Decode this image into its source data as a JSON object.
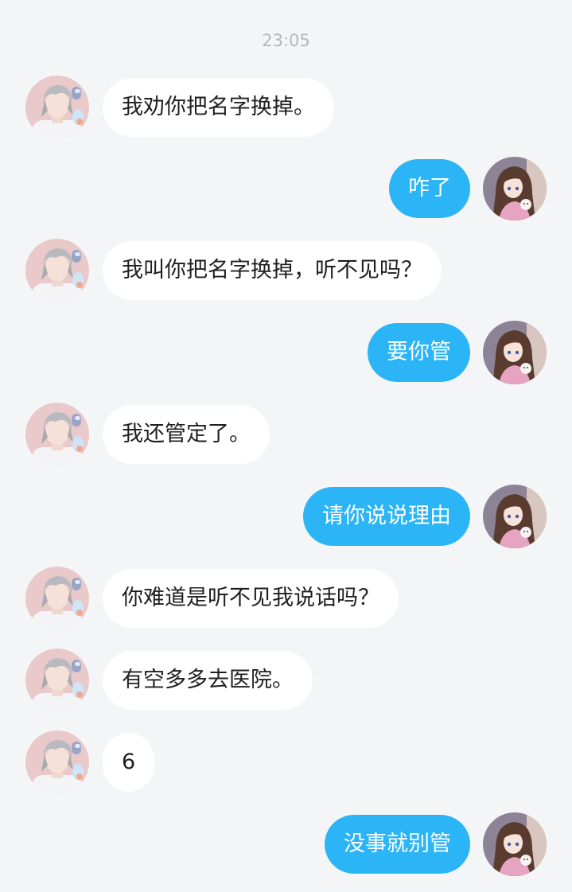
{
  "chat": {
    "timestamp": "23:05",
    "messages": [
      {
        "side": "left",
        "text": "我劝你把名字换掉。"
      },
      {
        "side": "right",
        "text": "咋了"
      },
      {
        "side": "left",
        "text": "我叫你把名字换掉，听不见吗？"
      },
      {
        "side": "right",
        "text": "要你管"
      },
      {
        "side": "left",
        "text": "我还管定了。"
      },
      {
        "side": "right",
        "text": "请你说说理由"
      },
      {
        "side": "left",
        "text": "你难道是听不见我说话吗？"
      },
      {
        "side": "left",
        "text": "有空多多去医院。"
      },
      {
        "side": "left",
        "text": "6"
      },
      {
        "side": "right",
        "text": "没事就别管"
      }
    ]
  },
  "colors": {
    "background": "#f4f5f7",
    "incoming_bubble": "#ffffff",
    "outgoing_bubble": "#2cb5f6",
    "timestamp_text": "#b4b7bd"
  },
  "icons": {
    "incoming_avatar": "avatar-silver-haired-boy-icon",
    "outgoing_avatar": "avatar-brown-haired-girl-icon"
  }
}
